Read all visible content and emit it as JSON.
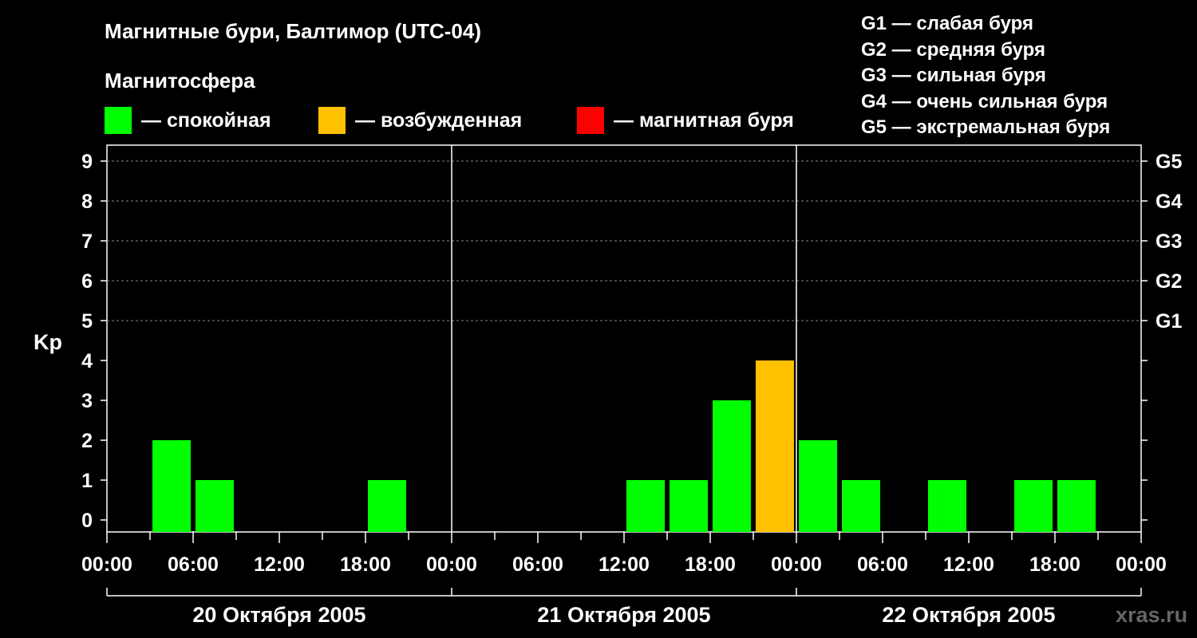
{
  "title": "Магнитные бури, Балтимор (UTC-04)",
  "magnetosphere_title": "Магнитосфера",
  "legend": [
    {
      "label": "— спокойная",
      "color": "#00ff00"
    },
    {
      "label": "— возбужденная",
      "color": "#ffc000"
    },
    {
      "label": "— магнитная буря",
      "color": "#ff0000"
    }
  ],
  "g_legend": [
    "G1 — слабая буря",
    "G2 — средняя буря",
    "G3 — сильная буря",
    "G4 — очень сильная буря",
    "G5 — экстремальная буря"
  ],
  "watermark": "xras.ru",
  "chart_data": {
    "type": "bar",
    "ylabel": "Kp",
    "ylim": [
      0,
      9
    ],
    "y_ticks": [
      "0",
      "1",
      "2",
      "3",
      "4",
      "5",
      "6",
      "7",
      "8",
      "9"
    ],
    "right_ticks": [
      {
        "value": 5,
        "label": "G1"
      },
      {
        "value": 6,
        "label": "G2"
      },
      {
        "value": 7,
        "label": "G3"
      },
      {
        "value": 8,
        "label": "G4"
      },
      {
        "value": 9,
        "label": "G5"
      }
    ],
    "grid": "dashed horizontal at Kp 5–9",
    "x_tick_labels": [
      "00:00",
      "06:00",
      "12:00",
      "18:00",
      "00:00",
      "06:00",
      "12:00",
      "18:00",
      "00:00",
      "06:00",
      "12:00",
      "18:00",
      "00:00"
    ],
    "days": [
      "20 Октября 2005",
      "21 Октября 2005",
      "22 Октября 2005"
    ],
    "bar_interval_hours": 3,
    "series": [
      {
        "values": [
          0,
          2,
          1,
          0,
          0,
          0,
          1,
          0,
          0,
          0,
          0,
          0,
          1,
          1,
          3,
          4,
          2,
          1,
          0,
          1,
          0,
          1,
          1,
          0
        ]
      }
    ],
    "color_scale": [
      {
        "max": 3,
        "color": "#00ff00"
      },
      {
        "max": 4,
        "color": "#ffc000"
      },
      {
        "max": 9,
        "color": "#ff0000"
      }
    ]
  }
}
